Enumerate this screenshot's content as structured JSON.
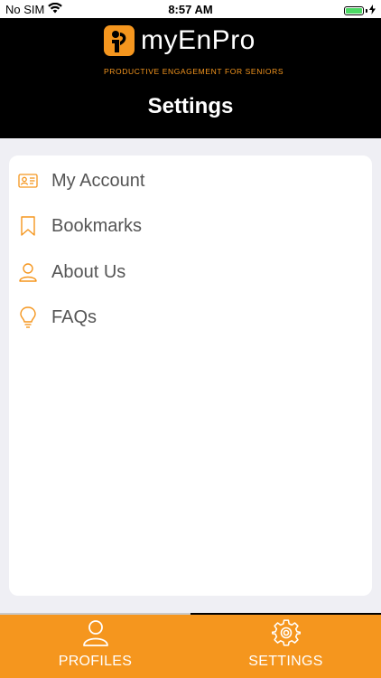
{
  "status_bar": {
    "carrier": "No SIM",
    "time": "8:57 AM",
    "battery_percent": 100
  },
  "header": {
    "logo_text": "myEnPro",
    "tagline": "PRODUCTIVE ENGAGEMENT FOR SENIORS",
    "title": "Settings"
  },
  "menu": {
    "items": [
      {
        "label": "My Account",
        "icon": "id-card-icon"
      },
      {
        "label": "Bookmarks",
        "icon": "bookmark-icon"
      },
      {
        "label": "About Us",
        "icon": "person-icon"
      },
      {
        "label": "FAQs",
        "icon": "lightbulb-icon"
      }
    ]
  },
  "tab_bar": {
    "tabs": [
      {
        "label": "PROFILES",
        "icon": "person-icon",
        "selected": false
      },
      {
        "label": "SETTINGS",
        "icon": "gear-icon",
        "selected": true
      }
    ]
  },
  "colors": {
    "accent": "#f5961e",
    "header_bg": "#000000",
    "page_bg": "#efeff4",
    "text": "#555555"
  }
}
